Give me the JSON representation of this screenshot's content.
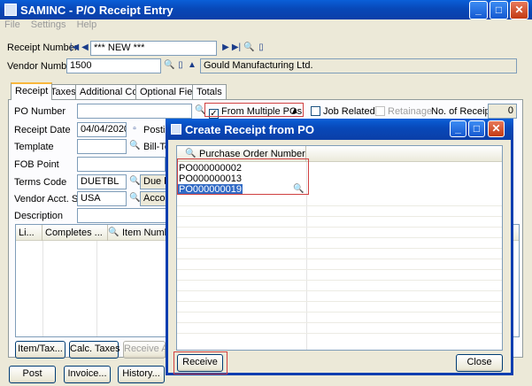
{
  "window": {
    "title": "SAMINC - P/O Receipt Entry"
  },
  "menu": [
    "File",
    "Settings",
    "Help"
  ],
  "header": {
    "receipt_number_label": "Receipt Number",
    "receipt_number_value": "*** NEW ***",
    "vendor_number_label": "Vendor Number",
    "vendor_number_value": "1500",
    "vendor_name": "Gould Manufacturing Ltd."
  },
  "tabs": [
    "Receipt",
    "Taxes",
    "Additional Costs",
    "Optional Fields",
    "Totals"
  ],
  "receipt": {
    "po_number_label": "PO Number",
    "from_multiple_pos": "From Multiple POs",
    "job_related": "Job Related",
    "retainage": "Retainage",
    "no_receipts_label": "No. of Receipts",
    "no_receipts_value": "0",
    "receipt_date_label": "Receipt Date",
    "receipt_date_value": "04/04/2020",
    "posting_label": "Posting",
    "template_label": "Template",
    "bill_to_label": "Bill-To",
    "fob_label": "FOB Point",
    "terms_label": "Terms Code",
    "terms_value": "DUETBL",
    "terms_desc": "Due by",
    "vendor_acct_label": "Vendor Acct. Set",
    "vendor_acct_value": "USA",
    "vendor_acct_desc": "Accou",
    "description_label": "Description"
  },
  "grid": {
    "columns": [
      "Li...",
      "Completes ...",
      "Item Number"
    ]
  },
  "mid_buttons": {
    "item_tax": "Item/Tax...",
    "calc_taxes": "Calc. Taxes",
    "receive_all": "Receive All"
  },
  "bottom_buttons": {
    "post": "Post",
    "invoice": "Invoice...",
    "history": "History..."
  },
  "dialog": {
    "title": "Create Receipt from PO",
    "column": "Purchase Order Number",
    "rows": [
      "PO000000002",
      "PO000000013",
      "PO000000019"
    ],
    "receive": "Receive",
    "close": "Close"
  }
}
